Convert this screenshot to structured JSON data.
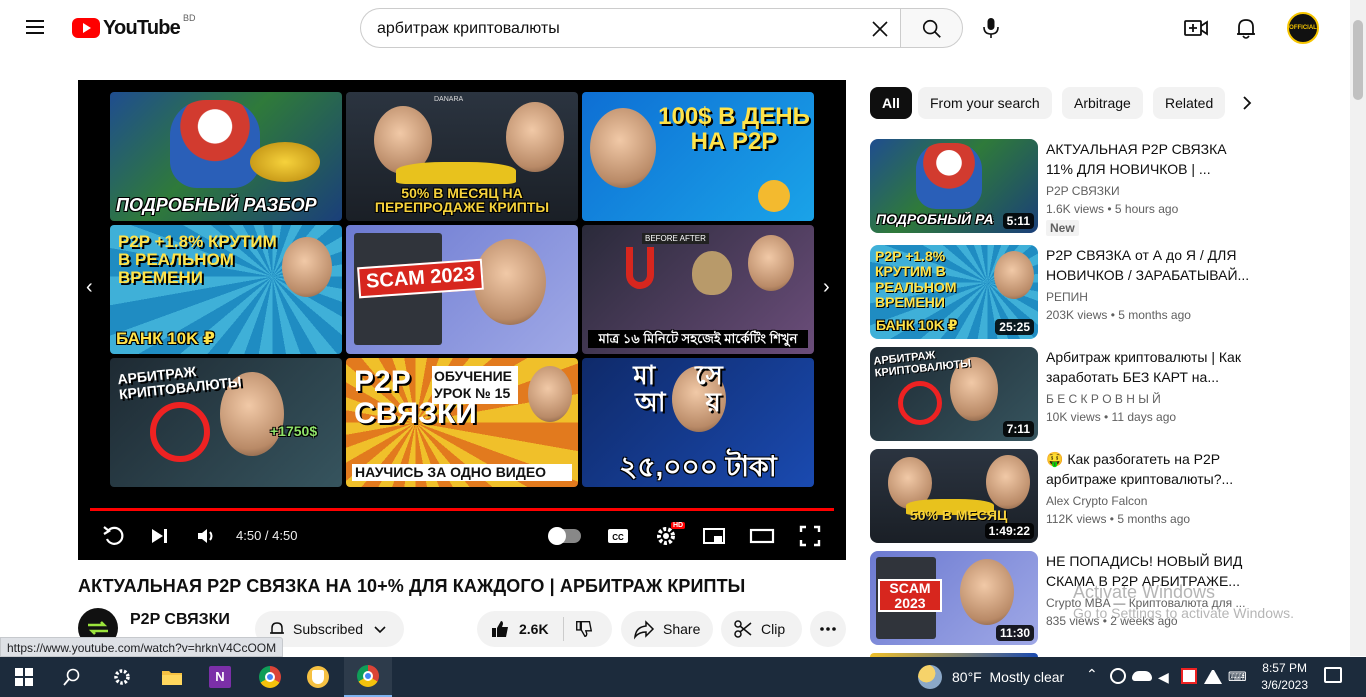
{
  "masthead": {
    "logo_text": "YouTube",
    "country_code": "BD",
    "search_value": "арбитраж криптовалюты",
    "search_placeholder": "Search",
    "avatar_label": "OFFICIAL"
  },
  "player": {
    "endscreen": [
      {
        "caption": "ПОДРОБНЫЙ РАЗБОР",
        "bg": "#2b4f8a"
      },
      {
        "caption": "50% В МЕСЯЦ НА ПЕРЕПРОДАЖЕ КРИПТЫ",
        "brand": "DANARA"
      },
      {
        "big": "100$ В ДЕНЬ НА P2P"
      },
      {
        "big": "P2P +1.8% КРУТИМ В РЕАЛЬНОМ ВРЕМЕНИ",
        "caption": "БАНК 10K ₽"
      },
      {
        "big": "SCAM 2023"
      },
      {
        "caption": "মাত্র ১৬ মিনিটে সহজেই মার্কেটিং শিখুন",
        "brand": "BEFORE AFTER"
      },
      {
        "big": "АРБИТРАЖ КРИПТОВАЛЮТЫ",
        "caption": "+1750$"
      },
      {
        "big": "P2P СВЯЗКИ",
        "caption": "НАУЧИСЬ ЗА ОДНО ВИДЕО",
        "side": "ОБУЧЕНИЕ УРОК № 15"
      },
      {
        "big": "মাসে আয়",
        "caption": "২৫,০০০ টাকা"
      }
    ],
    "time_current": "4:50",
    "time_total": "4:50",
    "time_display": "4:50 / 4:50",
    "progress": 1.0,
    "hd_badge": "HD"
  },
  "video": {
    "title": "АКТУАЛЬНАЯ P2P СВЯЗКА НА 10+% ДЛЯ КАЖДОГО | АРБИТРАЖ КРИПТЫ",
    "channel": "P2P СВЯЗКИ",
    "subscribe_label": "Subscribed",
    "likes": "2.6K",
    "share_label": "Share",
    "clip_label": "Clip"
  },
  "status_url": "https://www.youtube.com/watch?v=hrknV4CcOOM",
  "chips": [
    "All",
    "From your search",
    "Arbitrage",
    "Related"
  ],
  "recommendations": [
    {
      "title": "АКТУАЛЬНАЯ P2P СВЯЗКА 11% ДЛЯ НОВИЧКОВ | ...",
      "channel": "P2P СВЯЗКИ",
      "meta": "1.6K views  •  5 hours ago",
      "badge": "New",
      "duration": "5:11",
      "thumb_caption": "ПОДРОБНЫЙ РАЗ"
    },
    {
      "title": "P2P СВЯЗКА от А до Я / ДЛЯ НОВИЧКОВ / ЗАРАБАТЫВАЙ...",
      "channel": "РЕПИН",
      "meta": "203K views  •  5 months ago",
      "duration": "25:25",
      "thumb_caption": "БАНК 10K ₽"
    },
    {
      "title": "Арбитраж криптовалюты | Как заработать БЕЗ КАРТ на...",
      "channel": "Б Е С К Р О В Н Ы Й",
      "meta": "10K views  •  11 days ago",
      "duration": "7:11",
      "thumb_caption": "АРБИТРАЖ КРИПТОВАЛЮТЫ"
    },
    {
      "title": "🤑 Как разбогатеть на P2P арбитраже криптовалюты?...",
      "channel": "Alex Crypto Falcon",
      "meta": "112K views  •  5 months ago",
      "duration": "1:49:22",
      "thumb_caption": "50% В МЕСЯЦ"
    },
    {
      "title": "НЕ ПОПАДИСЬ! НОВЫЙ ВИД СКАМА В P2P АРБИТРАЖЕ...",
      "channel": "Crypto MBA — Криптовалюта для ...",
      "meta": "835 views  •  2 weeks ago",
      "duration": "11:30",
      "thumb_caption": "SCAM 2023"
    }
  ],
  "watermark": {
    "title": "Activate Windows",
    "subtitle": "Go to Settings to activate Windows."
  },
  "taskbar": {
    "weather": "80°F  Mostly clear",
    "time": "8:57 PM",
    "date": "3/6/2023"
  },
  "colors": {
    "brand_red": "#ff0000",
    "taskbar": "#1c2b3c",
    "chip_active": "#0f0f0f"
  }
}
